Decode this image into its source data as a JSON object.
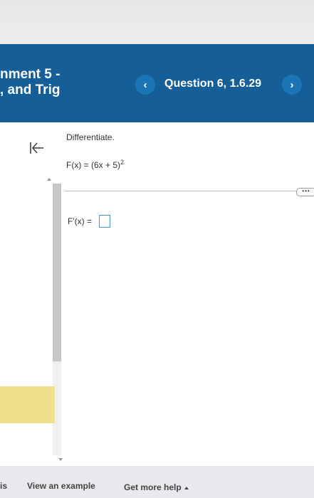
{
  "header": {
    "assignment_line1": "nment 5 -",
    "assignment_line2": ", and Trig",
    "question_label": "Question 6, 1.6.29",
    "prev_icon": "‹",
    "next_icon": "›",
    "background_color": "#155e97"
  },
  "problem": {
    "instruction": "Differentiate.",
    "function_lhs": "F(x) = (6x + 5)",
    "function_exponent": "2",
    "more_label": "•••",
    "answer_label": "F'(x) =",
    "answer_value": ""
  },
  "footer": {
    "left_text": "is",
    "view_example": "View an example",
    "get_more_help": "Get more help"
  },
  "icons": {
    "collapse": "collapse-left-icon",
    "prev": "chevron-left-icon",
    "next": "chevron-right-icon",
    "help_caret": "caret-up-icon"
  }
}
